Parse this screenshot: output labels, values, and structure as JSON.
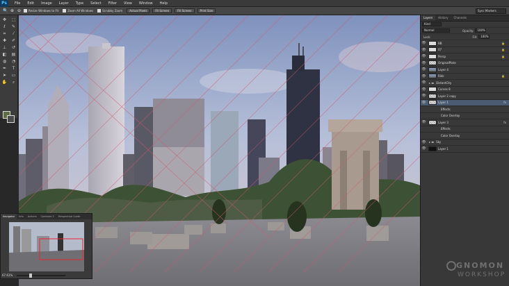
{
  "app": {
    "logo": "Ps",
    "menus": [
      "File",
      "Edit",
      "Image",
      "Layer",
      "Type",
      "Select",
      "Filter",
      "View",
      "Window",
      "Help"
    ]
  },
  "options_bar": {
    "checks": [
      "Resize Windows to Fit",
      "Zoom All Windows",
      "Scrubby Zoom"
    ],
    "buttons": [
      "Actual Pixels",
      "Fit Screen",
      "Fill Screen",
      "Print Size"
    ],
    "workspace": "Sync Markers"
  },
  "layers_panel": {
    "tabs": [
      "Layers",
      "History",
      "Channels"
    ],
    "filter_kind": "Kind",
    "blend_mode": "Normal",
    "opacity_label": "Opacity:",
    "opacity": "100%",
    "lock_label": "Lock:",
    "fill_label": "Fill:",
    "fill": "100%",
    "layers": [
      {
        "name": "BB",
        "thumb": "light",
        "locked": true
      },
      {
        "name": "07",
        "thumb": "light",
        "locked": true
      },
      {
        "name": "Persp",
        "thumb": "light",
        "locked": true
      },
      {
        "name": "OriginalPlate",
        "thumb": "checker",
        "locked": false
      },
      {
        "name": "Layer 4",
        "thumb": "photo",
        "locked": false
      },
      {
        "name": "Rikk",
        "thumb": "photo",
        "locked": true
      },
      {
        "name": "DistantCity",
        "thumb": "folder",
        "locked": false
      },
      {
        "name": "Curves 8",
        "thumb": "light",
        "locked": false
      },
      {
        "name": "Layer 2 copy",
        "thumb": "checker",
        "locked": false
      },
      {
        "name": "Layer 1",
        "thumb": "checker",
        "locked": false,
        "selected": true,
        "fx": "fx"
      },
      {
        "name": "Effects",
        "thumb": "none",
        "locked": false
      },
      {
        "name": "Color Overlay",
        "thumb": "none",
        "locked": false
      },
      {
        "name": "Layer 3",
        "thumb": "checker",
        "locked": false,
        "fx": "fx"
      },
      {
        "name": "Effects",
        "thumb": "none",
        "locked": false
      },
      {
        "name": "Color Overlay",
        "thumb": "none",
        "locked": false
      },
      {
        "name": "Sky",
        "thumb": "folder",
        "locked": false
      },
      {
        "name": "Layer 1",
        "thumb": "dark",
        "locked": false
      }
    ]
  },
  "navigator": {
    "tabs": [
      "Navigator",
      "Info",
      "Actions",
      "Contents 2",
      "Perspective Guide"
    ],
    "zoom": "67.61%"
  },
  "watermark": {
    "line1": "GNOMON",
    "line2": "WORKSHOP"
  }
}
